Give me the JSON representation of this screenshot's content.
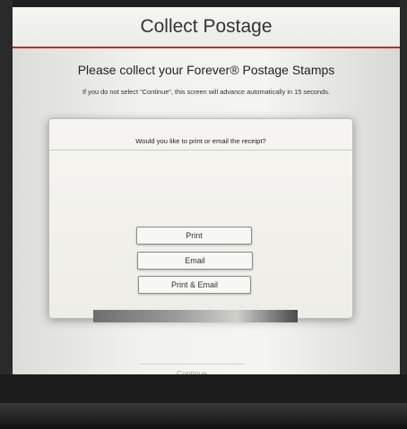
{
  "header": {
    "title": "Collect Postage"
  },
  "main": {
    "subtitle": "Please collect your Forever® Postage Stamps",
    "notice": "If you do not select \"Continue\", this screen will advance automatically in 15 seconds."
  },
  "dialog": {
    "question": "Would you like to print or email the receipt?",
    "buttons": [
      "Print",
      "Email",
      "Print & Email"
    ]
  },
  "footer": {
    "continue_label": "Continue"
  },
  "colors": {
    "header_rule": "#b5302f"
  }
}
